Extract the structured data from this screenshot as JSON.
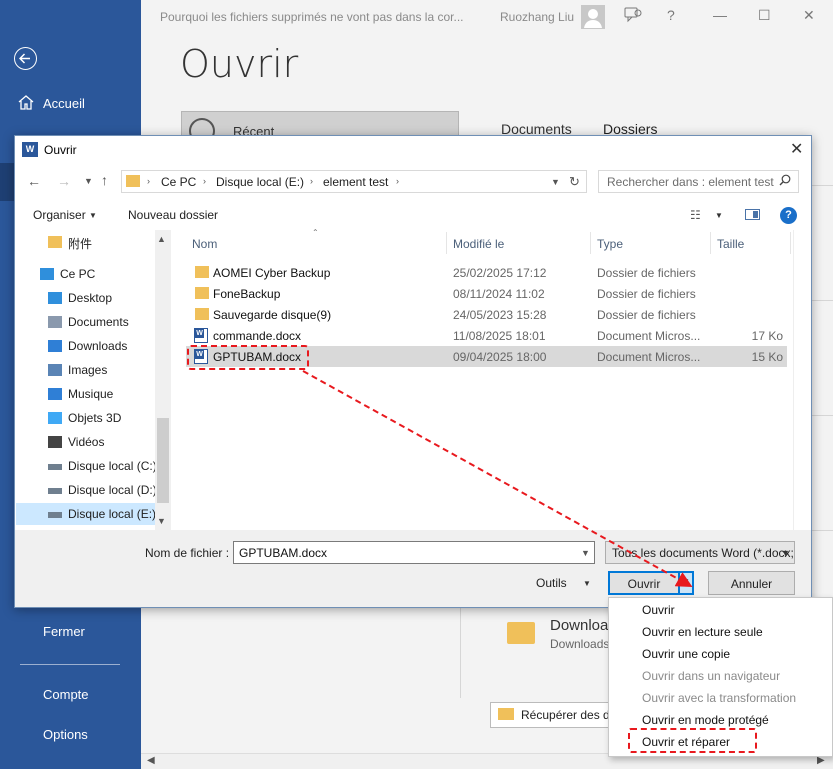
{
  "backstage": {
    "doc_title": "Pourquoi les fichiers supprimés ne vont pas dans la cor...",
    "user_name": "Ruozhang Liu",
    "heading": "Ouvrir",
    "recent_label": "Récent",
    "tab_documents": "Documents",
    "tab_folders": "Dossiers",
    "download_title": "Download",
    "download_sub": "Downloads",
    "recover_label": "Récupérer des documents non enregistrés",
    "window_controls": {
      "minimize": "—",
      "maximize": "☐",
      "close": "✕",
      "help": "?"
    }
  },
  "sidebar": {
    "home": "Accueil",
    "close": "Fermer",
    "account": "Compte",
    "options": "Options"
  },
  "dialog": {
    "title": "Ouvrir",
    "breadcrumbs": [
      "Ce PC",
      "Disque local (E:)",
      "element test"
    ],
    "search_placeholder": "Rechercher dans : element test",
    "organize": "Organiser",
    "new_folder": "Nouveau dossier",
    "nav_items": [
      {
        "label": "附件",
        "icon": "folder-icon",
        "color": "#f0c05a"
      },
      {
        "label": "Ce PC",
        "icon": "computer-icon",
        "color": "#2f8fdc"
      },
      {
        "label": "Desktop",
        "icon": "desktop-icon",
        "color": "#2f8fdc"
      },
      {
        "label": "Documents",
        "icon": "documents-icon",
        "color": "#8a99ad"
      },
      {
        "label": "Downloads",
        "icon": "download-icon",
        "color": "#2f7fd6"
      },
      {
        "label": "Images",
        "icon": "images-icon",
        "color": "#5a84b5"
      },
      {
        "label": "Musique",
        "icon": "music-icon",
        "color": "#2f7fd6"
      },
      {
        "label": "Objets 3D",
        "icon": "objects-3d-icon",
        "color": "#3fa9f5"
      },
      {
        "label": "Vidéos",
        "icon": "videos-icon",
        "color": "#444444"
      },
      {
        "label": "Disque local (C:)",
        "icon": "drive-icon",
        "color": "#6f7f8f"
      },
      {
        "label": "Disque local (D:)",
        "icon": "drive-icon",
        "color": "#6f7f8f"
      },
      {
        "label": "Disque local (E:)",
        "icon": "drive-icon",
        "color": "#6f7f8f"
      }
    ],
    "columns": {
      "name": "Nom",
      "modified": "Modifié le",
      "type": "Type",
      "size": "Taille"
    },
    "files": [
      {
        "name": "AOMEI Cyber Backup",
        "modified": "25/02/2025 17:12",
        "type": "Dossier de fichiers",
        "size": "",
        "kind": "folder"
      },
      {
        "name": "FoneBackup",
        "modified": "08/11/2024 11:02",
        "type": "Dossier de fichiers",
        "size": "",
        "kind": "folder"
      },
      {
        "name": "Sauvegarde disque(9)",
        "modified": "24/05/2023 15:28",
        "type": "Dossier de fichiers",
        "size": "",
        "kind": "folder"
      },
      {
        "name": "commande.docx",
        "modified": "11/08/2025 18:01",
        "type": "Document Micros...",
        "size": "17 Ko",
        "kind": "word"
      },
      {
        "name": "GPTUBAM.docx",
        "modified": "09/04/2025 18:00",
        "type": "Document Micros...",
        "size": "15 Ko",
        "kind": "word"
      }
    ],
    "filename_label": "Nom de fichier :",
    "filename_value": "GPTUBAM.docx",
    "filetype": "Tous les documents Word (*.docx;*.docm;*.dotx)",
    "tools": "Outils",
    "open": "Ouvrir",
    "cancel": "Annuler"
  },
  "open_menu": [
    {
      "label": "Ouvrir",
      "enabled": true
    },
    {
      "label": "Ouvrir en lecture seule",
      "enabled": true
    },
    {
      "label": "Ouvrir une copie",
      "enabled": true
    },
    {
      "label": "Ouvrir dans un navigateur",
      "enabled": false
    },
    {
      "label": "Ouvrir avec la transformation",
      "enabled": false
    },
    {
      "label": "Ouvrir en mode protégé",
      "enabled": true
    },
    {
      "label": "Ouvrir et réparer",
      "enabled": true
    }
  ],
  "colors": {
    "word_blue": "#2b579a",
    "annotation_red": "#e8191e",
    "selection": "#cce8ff"
  }
}
